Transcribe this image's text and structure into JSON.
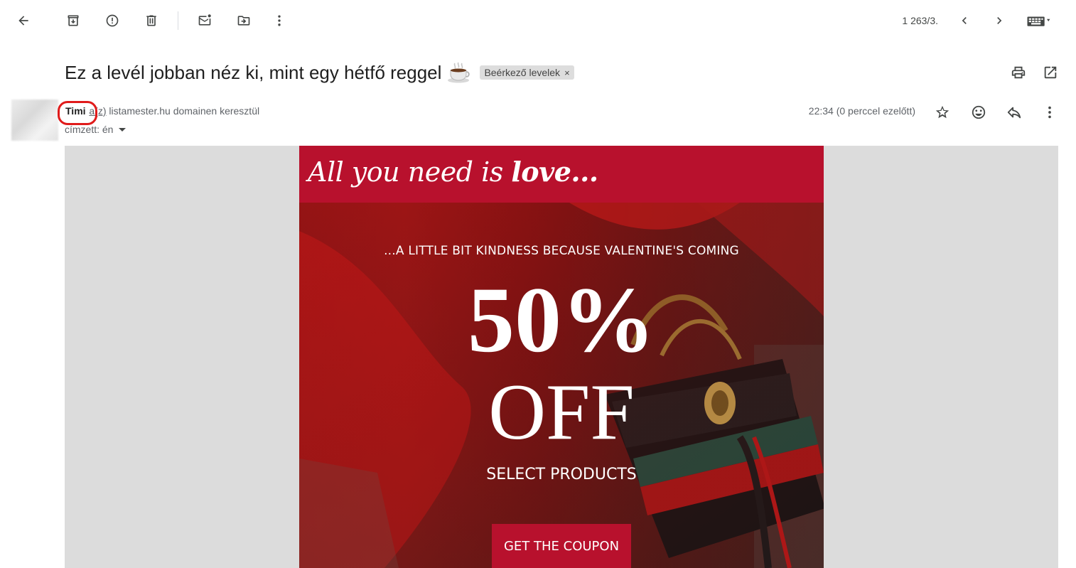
{
  "toolbar": {
    "pager": "1 263/3."
  },
  "email": {
    "subject": "Ez a levél jobban néz ki, mint egy hétfő reggel",
    "label": "Beérkező levelek",
    "label_remove": "×",
    "sender_name": "Timi",
    "sender_via_prefix": "a(z)",
    "sender_via_rest": " listamester.hu domainen keresztül",
    "recipient": "címzett: én",
    "time": "22:34 (0 perccel ezelőtt)"
  },
  "content": {
    "tagline_prefix": "All you need is ",
    "tagline_bold": "love...",
    "preheader": "...A LITTLE BIT KINDNESS BECAUSE VALENTINE'S COMING",
    "discount": "50%",
    "off": "OFF",
    "subheading": "SELECT PRODUCTS",
    "cta": "GET THE COUPON"
  },
  "colors": {
    "accent": "#b8112d",
    "highlight": "#e01b1b"
  }
}
